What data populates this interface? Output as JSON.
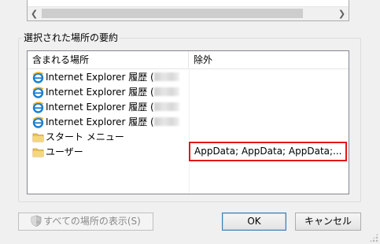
{
  "group": {
    "title": "選択された場所の要約"
  },
  "listview": {
    "columns": [
      "含まれる場所",
      "除外"
    ],
    "rows": [
      {
        "name": "Internet Explorer 履歴 (",
        "icon": "ie-icon",
        "blurred_suffix": true
      },
      {
        "name": "Internet Explorer 履歴 (",
        "icon": "ie-icon",
        "blurred_suffix": true
      },
      {
        "name": "Internet Explorer 履歴 (",
        "icon": "ie-icon",
        "blurred_suffix": true
      },
      {
        "name": "Internet Explorer 履歴 (",
        "icon": "ie-icon",
        "blurred_suffix": true
      },
      {
        "name": "スタート メニュー",
        "icon": "folder-icon",
        "blurred_suffix": false
      },
      {
        "name": "ユーザー",
        "icon": "folder-icon",
        "blurred_suffix": false
      }
    ],
    "exclusion": "AppData; AppData; AppData;..."
  },
  "buttons": {
    "show_all": "すべての場所の表示(S)",
    "ok": "OK",
    "cancel": "キャンセル"
  },
  "colors": {
    "highlight": "#e01818",
    "ok_border": "#3c7fb1"
  }
}
